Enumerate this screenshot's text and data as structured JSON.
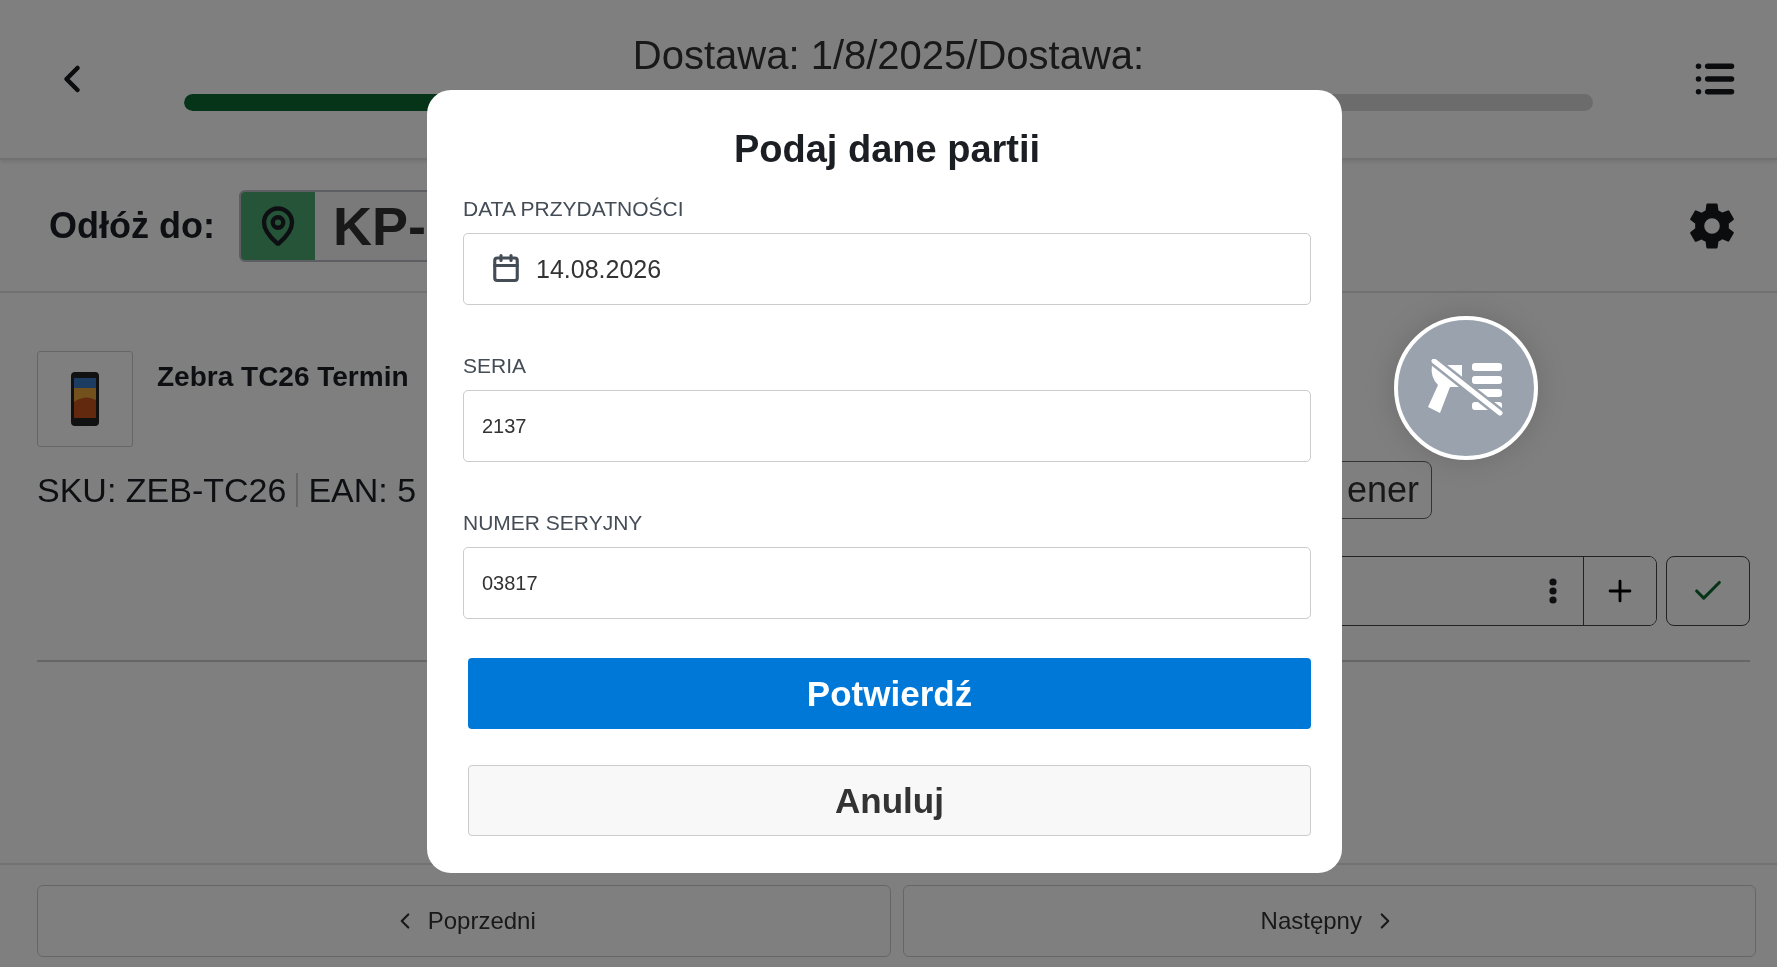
{
  "header": {
    "title": "Dostawa: 1/8/2025/Dostawa:",
    "progress": {
      "level": 0.3
    }
  },
  "location_bar": {
    "label": "Odłóż do:",
    "location": "KP-"
  },
  "product": {
    "name": "Zebra TC26 Termin",
    "sku": "SKU: ZEB-TC26",
    "ean": "EAN: 5",
    "container_button": "ener"
  },
  "scanner": {
    "enabled": false
  },
  "nav": {
    "previous": "Poprzedni",
    "next": "Następny"
  },
  "dialog": {
    "title": "Podaj dane partii",
    "fields": [
      {
        "kind": "date",
        "label": "DATA PRZYDATNOŚCI",
        "value": "14.08.2026"
      },
      {
        "kind": "text",
        "label": "SERIA",
        "value": "2137"
      },
      {
        "kind": "text",
        "label": "NUMER SERYJNY",
        "value": "03817"
      }
    ],
    "confirm": "Potwierdź",
    "cancel": "Anuluj"
  }
}
